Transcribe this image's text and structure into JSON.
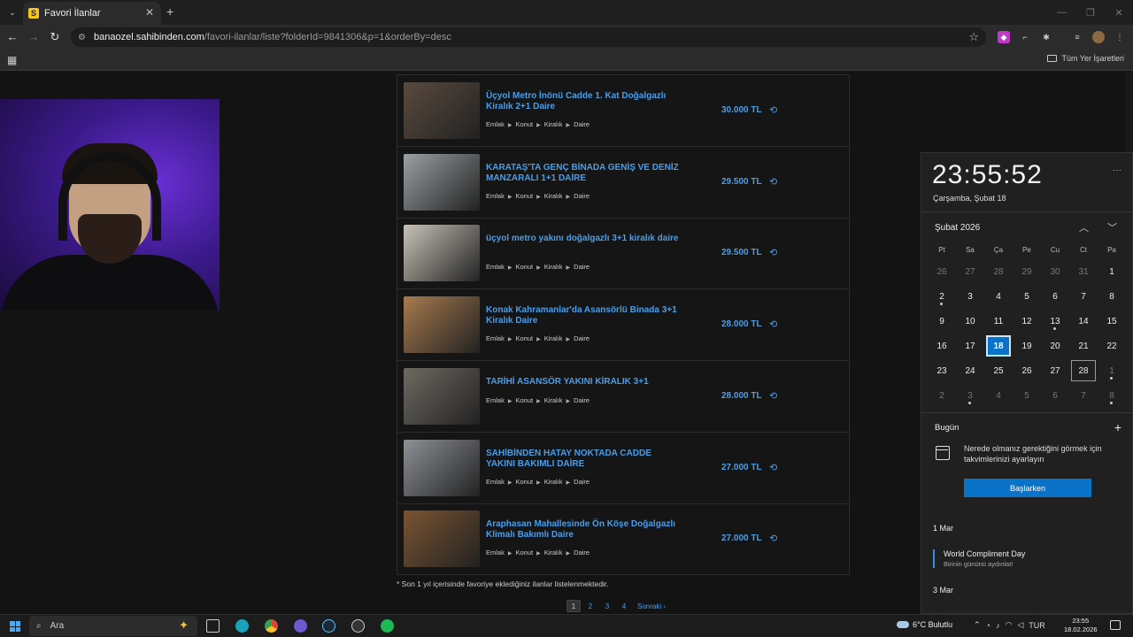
{
  "browser": {
    "tab_title": "Favori İlanlar",
    "url_host": "banaozel.sahibinden.com",
    "url_path": "/favori-ilanlar/liste?folderId=9841306&p=1&orderBy=desc",
    "all_bookmarks": "Tüm Yer İşaretleri"
  },
  "listings": [
    {
      "title": "Üçyol Metro İnönü Cadde 1. Kat Doğalgazlı Kiralık 2+1 Daire",
      "price": "30.000 TL",
      "crumbs": [
        "Emlak",
        "Konut",
        "Kiralık",
        "Daire"
      ],
      "thumb": "#5a4a3e"
    },
    {
      "title": "KARATAŞ'TA GENÇ BİNADA GENİŞ VE DENİZ MANZARALI 1+1 DAİRE",
      "price": "29.500 TL",
      "crumbs": [
        "Emlak",
        "Konut",
        "Kiralık",
        "Daire"
      ],
      "thumb": "#9aa0a3"
    },
    {
      "title": "üçyol metro yakını doğalgazlı 3+1 kiralık daire",
      "price": "29.500 TL",
      "crumbs": [
        "Emlak",
        "Konut",
        "Kiralık",
        "Daire"
      ],
      "thumb": "#c8c2b8"
    },
    {
      "title": "Konak Kahramanlar'da Asansörlü Binada 3+1 Kiralık Daire",
      "price": "28.000 TL",
      "crumbs": [
        "Emlak",
        "Konut",
        "Kiralık",
        "Daire"
      ],
      "thumb": "#a77a4e"
    },
    {
      "title": "TARİHİ ASANSÖR YAKINI KİRALIK 3+1",
      "price": "28.000 TL",
      "crumbs": [
        "Emlak",
        "Konut",
        "Kiralık",
        "Daire"
      ],
      "thumb": "#6e6a62"
    },
    {
      "title": "SAHİBİNDEN HATAY NOKTADA CADDE YAKINI BAKIMLI DAİRE",
      "price": "27.000 TL",
      "crumbs": [
        "Emlak",
        "Konut",
        "Kiralık",
        "Daire"
      ],
      "thumb": "#8d9096"
    },
    {
      "title": "Araphasan Mahallesinde Ön Köşe Doğalgazlı Klimalı Bakımlı Daire",
      "price": "27.000 TL",
      "crumbs": [
        "Emlak",
        "Konut",
        "Kiralık",
        "Daire"
      ],
      "thumb": "#7a5432"
    }
  ],
  "note": "* Son 1 yıl içerisinde favoriye eklediğiniz ilanlar listelenmektedir.",
  "pager": {
    "pages": [
      "1",
      "2",
      "3",
      "4"
    ],
    "next": "Sonraki"
  },
  "calendar": {
    "time": "23:55:52",
    "date_long": "Çarşamba, Şubat 18",
    "month": "Şubat 2026",
    "dow": [
      "Pt",
      "Sa",
      "Ça",
      "Pe",
      "Cu",
      "Ct",
      "Pa"
    ],
    "weeks": [
      [
        "26",
        "27",
        "28",
        "29",
        "30",
        "31",
        "1"
      ],
      [
        "2",
        "3",
        "4",
        "5",
        "6",
        "7",
        "8"
      ],
      [
        "9",
        "10",
        "11",
        "12",
        "13",
        "14",
        "15"
      ],
      [
        "16",
        "17",
        "18",
        "19",
        "20",
        "21",
        "22"
      ],
      [
        "23",
        "24",
        "25",
        "26",
        "27",
        "28",
        "1"
      ],
      [
        "2",
        "3",
        "4",
        "5",
        "6",
        "7",
        "8"
      ]
    ],
    "today_label": "Bugün",
    "hint": "Nerede olmanız gerektiğini görmek için takvimlerinizi ayarlayın",
    "start_button": "Başlarken",
    "events": [
      {
        "date": "1 Mar",
        "title": "World Compliment Day",
        "subtitle": "Birinin gününü aydınlat!"
      },
      {
        "date": "3 Mar"
      }
    ]
  },
  "taskbar": {
    "search": "Ara",
    "weather": "6°C Bulutlu",
    "lang": "TUR",
    "time": "23:55",
    "date": "18.02.2026"
  }
}
